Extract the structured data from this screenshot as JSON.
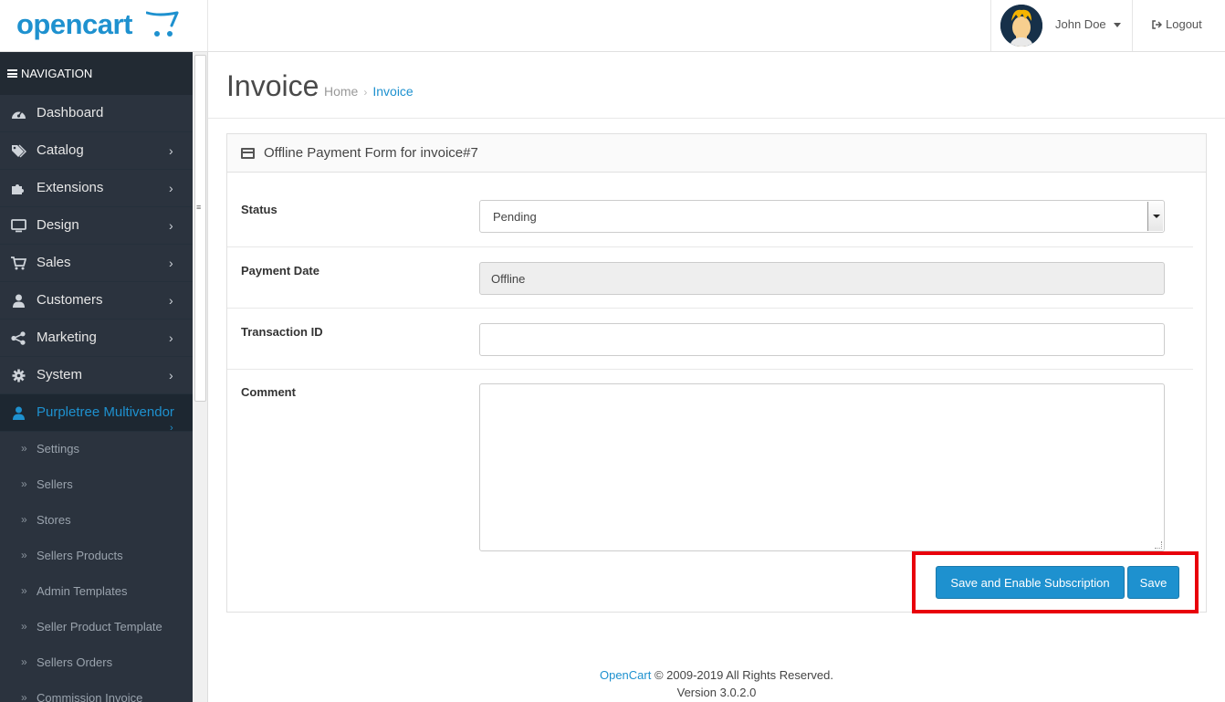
{
  "header": {
    "logo_text": "opencart",
    "user_name": "John Doe",
    "logout_label": "Logout"
  },
  "sidebar": {
    "nav_title": "NAVIGATION",
    "items": [
      {
        "label": "Dashboard",
        "icon": "dashboard-icon"
      },
      {
        "label": "Catalog",
        "icon": "tags-icon"
      },
      {
        "label": "Extensions",
        "icon": "puzzle-icon"
      },
      {
        "label": "Design",
        "icon": "monitor-icon"
      },
      {
        "label": "Sales",
        "icon": "cart-icon"
      },
      {
        "label": "Customers",
        "icon": "user-icon"
      },
      {
        "label": "Marketing",
        "icon": "share-icon"
      },
      {
        "label": "System",
        "icon": "gear-icon"
      },
      {
        "label": "Purpletree Multivendor",
        "icon": "user-icon"
      }
    ],
    "sub_items": [
      "Settings",
      "Sellers",
      "Stores",
      "Sellers Products",
      "Admin Templates",
      "Seller Product Template",
      "Sellers Orders",
      "Commission Invoice"
    ]
  },
  "page": {
    "title": "Invoice",
    "breadcrumb": [
      "Home",
      "Invoice"
    ]
  },
  "panel": {
    "title": "Offline Payment Form for invoice#7",
    "status_label": "Status",
    "status_value": "Pending",
    "payment_date_label": "Payment Date",
    "payment_date_value": "Offline",
    "transaction_label": "Transaction ID",
    "transaction_value": "",
    "comment_label": "Comment",
    "save_enable_label": "Save and Enable Subscription",
    "save_label": "Save"
  },
  "footer": {
    "brand": "OpenCart",
    "copyright": " © 2009-2019 All Rights Reserved.",
    "version": "Version 3.0.2.0"
  },
  "colors": {
    "accent": "#1e91cf",
    "sidebar": "#2b333e",
    "highlight": "#e8000b"
  }
}
